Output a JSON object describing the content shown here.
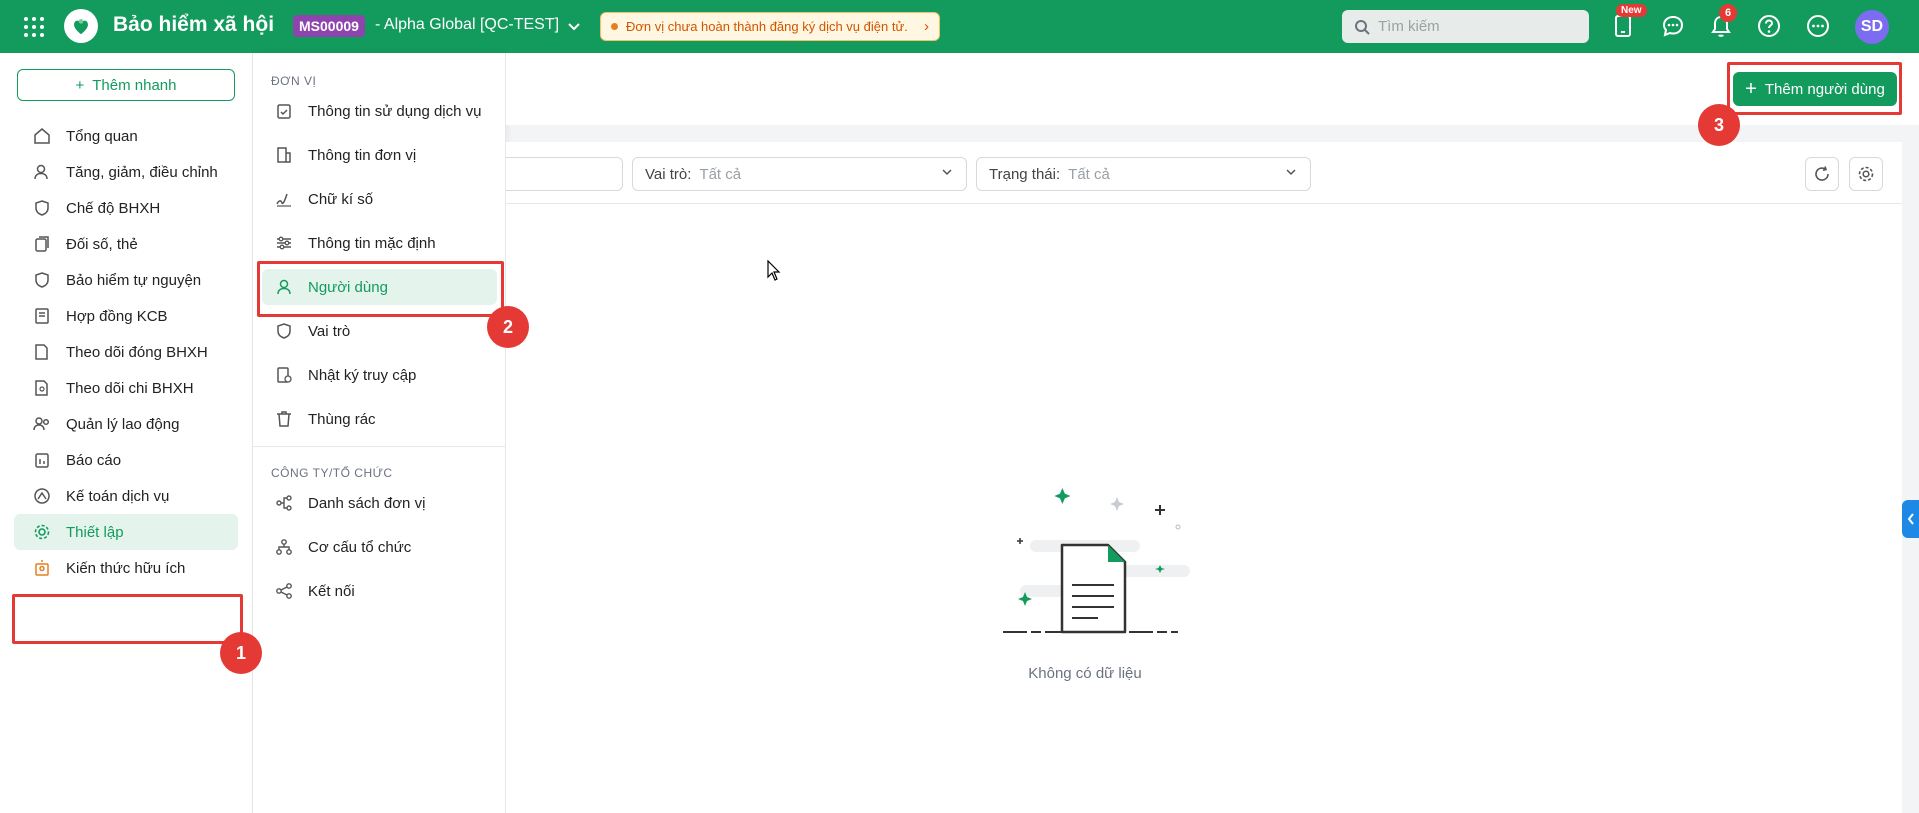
{
  "header": {
    "app_title": "Bảo hiểm xã hội",
    "tenant_code": "MS00009",
    "tenant_name": "- Alpha Global [QC-TEST]",
    "warning": "Đơn vị chưa hoàn thành đăng ký dịch vụ điện tử.",
    "search_placeholder": "Tìm kiếm",
    "badge_new": "New",
    "notification_count": "6",
    "avatar_initials": "SD"
  },
  "sidebar": {
    "quick_add": "Thêm nhanh",
    "items": [
      {
        "label": "Tổng quan",
        "icon": "home-icon"
      },
      {
        "label": "Tăng, giảm, điều chỉnh",
        "icon": "user-adjust-icon"
      },
      {
        "label": "Chế độ BHXH",
        "icon": "heart-shield-icon"
      },
      {
        "label": "Đối số, thẻ",
        "icon": "cards-icon"
      },
      {
        "label": "Bảo hiểm tự nguyện",
        "icon": "shield-icon"
      },
      {
        "label": "Hợp đồng KCB",
        "icon": "contract-icon"
      },
      {
        "label": "Theo dõi đóng BHXH",
        "icon": "c12-document-icon"
      },
      {
        "label": "Theo dõi chi BHXH",
        "icon": "payment-document-icon"
      },
      {
        "label": "Quản lý lao động",
        "icon": "users-icon"
      },
      {
        "label": "Báo cáo",
        "icon": "report-icon"
      },
      {
        "label": "Kế toán dịch vụ",
        "icon": "accounting-icon"
      },
      {
        "label": "Thiết lập",
        "icon": "gear-icon"
      },
      {
        "label": "Kiến thức hữu ích",
        "icon": "knowledge-icon"
      }
    ]
  },
  "submenu": {
    "section1": "Đơn vị",
    "section1_items": [
      {
        "label": "Thông tin sử dụng dịch vụ",
        "icon": "clipboard-check-icon"
      },
      {
        "label": "Thông tin đơn vị",
        "icon": "building-icon"
      },
      {
        "label": "Chữ kí số",
        "icon": "signature-icon"
      },
      {
        "label": "Thông tin mặc định",
        "icon": "sliders-icon"
      },
      {
        "label": "Người dùng",
        "icon": "user-icon"
      },
      {
        "label": "Vai trò",
        "icon": "shield-outline-icon"
      },
      {
        "label": "Nhật ký truy cập",
        "icon": "log-clock-icon"
      },
      {
        "label": "Thùng rác",
        "icon": "trash-icon"
      }
    ],
    "section2": "Công ty/Tổ chức",
    "section2_items": [
      {
        "label": "Danh sách đơn vị",
        "icon": "org-list-icon"
      },
      {
        "label": "Cơ cấu tổ chức",
        "icon": "org-tree-icon"
      },
      {
        "label": "Kết nối",
        "icon": "share-icon"
      }
    ]
  },
  "main": {
    "add_user_button": "Thêm người dùng",
    "filter_role_label": "Vai trò:",
    "filter_role_value": "Tất cả",
    "filter_status_label": "Trạng thái:",
    "filter_status_value": "Tất cả",
    "empty_text": "Không có dữ liệu"
  },
  "annotations": {
    "step1": "1",
    "step2": "2",
    "step3": "3"
  },
  "colors": {
    "brand": "#139b5e",
    "highlight": "#e53935",
    "active_bg": "#e4f4ec"
  }
}
